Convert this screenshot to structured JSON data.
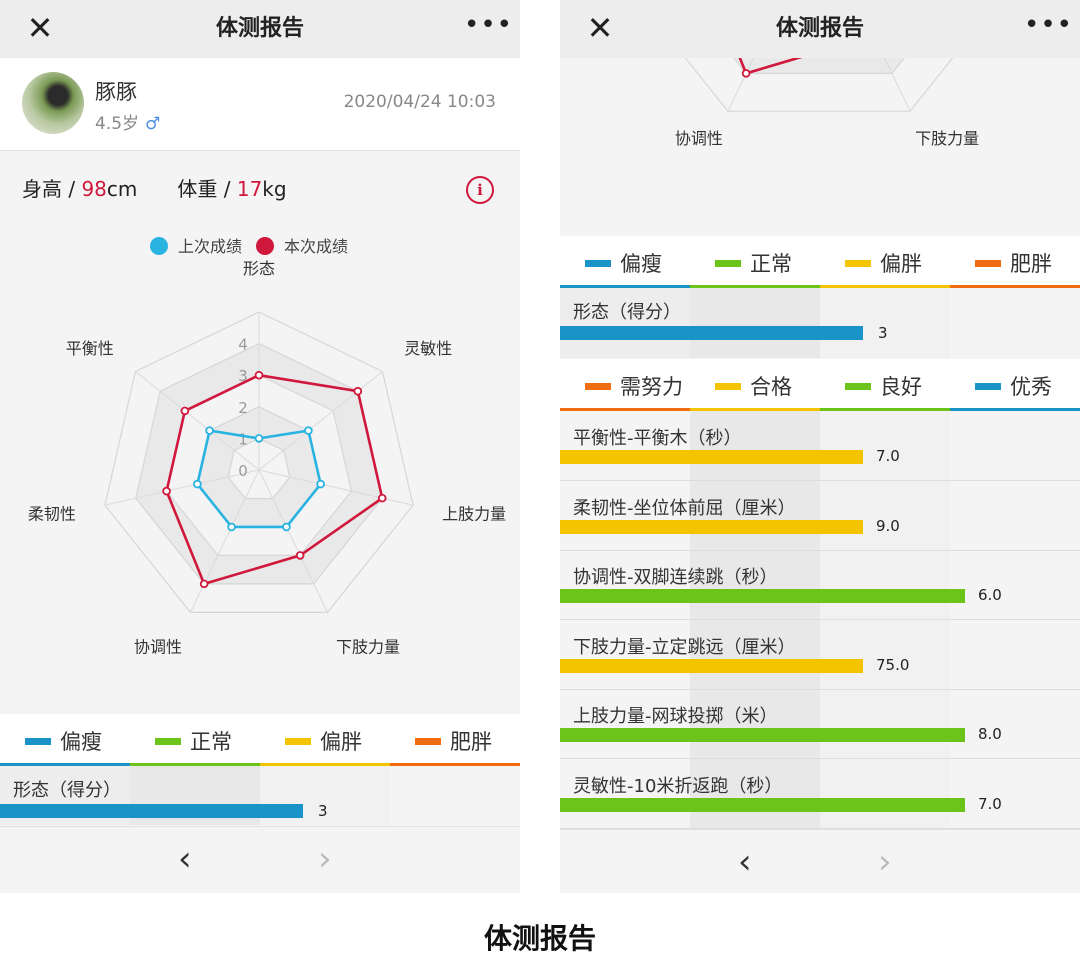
{
  "nav": {
    "title": "体测报告",
    "close_glyph": "✕",
    "more_glyph": "•••"
  },
  "profile": {
    "name": "豚豚",
    "age": "4.5岁",
    "gender_symbol": "♂",
    "datetime": "2020/04/24 10:03"
  },
  "metrics": {
    "height_label": "身高 / ",
    "height_value": "98",
    "height_unit": "cm",
    "weight_label": "体重 / ",
    "weight_value": "17",
    "weight_unit": "kg",
    "info_glyph": "i"
  },
  "radar": {
    "legend": [
      {
        "label": "上次成绩",
        "color": "#29b3e0"
      },
      {
        "label": "本次成绩",
        "color": "#d0183c"
      }
    ],
    "axes": [
      "形态",
      "灵敏性",
      "上肢力量",
      "下肢力量",
      "协调性",
      "柔韧性",
      "平衡性"
    ],
    "ticks": [
      "0",
      "1",
      "2",
      "3",
      "4"
    ],
    "previous": [
      1,
      2,
      2,
      2,
      2,
      2,
      2
    ],
    "current": [
      3,
      4,
      4,
      3,
      4,
      3,
      3
    ],
    "max": 5
  },
  "body_legend": [
    {
      "label": "偏瘦",
      "color": "#1a93c8"
    },
    {
      "label": "正常",
      "color": "#6cc31a"
    },
    {
      "label": "偏胖",
      "color": "#f5c400"
    },
    {
      "label": "肥胖",
      "color": "#f06c10"
    }
  ],
  "score_legend": [
    {
      "label": "需努力",
      "color": "#f06c10"
    },
    {
      "label": "合格",
      "color": "#f5c400"
    },
    {
      "label": "良好",
      "color": "#6cc31a"
    },
    {
      "label": "优秀",
      "color": "#1a93c8"
    }
  ],
  "morphology": {
    "label": "形态（得分）",
    "value": "3",
    "level": 2,
    "color": "#1a93c8"
  },
  "items": [
    {
      "label": "平衡性-平衡木（秒）",
      "value": "7.0",
      "level": 2,
      "color": "#f5c400"
    },
    {
      "label": "柔韧性-坐位体前屈（厘米）",
      "value": "9.0",
      "level": 2,
      "color": "#f5c400"
    },
    {
      "label": "协调性-双脚连续跳（秒）",
      "value": "6.0",
      "level": 3,
      "color": "#6cc31a"
    },
    {
      "label": "下肢力量-立定跳远（厘米）",
      "value": "75.0",
      "level": 2,
      "color": "#f5c400"
    },
    {
      "label": "上肢力量-网球投掷（米）",
      "value": "8.0",
      "level": 3,
      "color": "#6cc31a"
    },
    {
      "label": "灵敏性-10米折返跑（秒）",
      "value": "7.0",
      "level": 3,
      "color": "#6cc31a"
    }
  ],
  "pager": {
    "prev_glyph": "‹",
    "next_glyph": "›"
  },
  "caption": "体测报告"
}
